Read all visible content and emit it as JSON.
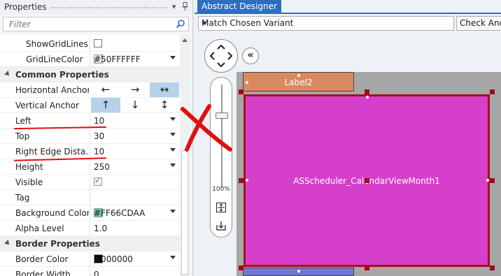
{
  "properties_panel": {
    "title": "Properties",
    "pin_icon": "pin-icon",
    "dropdown_icon": "chevron-down-icon",
    "filter_placeholder": "Filter",
    "rows": {
      "show_grid_lines": {
        "name": "ShowGridLines",
        "checked": false
      },
      "grid_line_color": {
        "name": "GridLineColor",
        "value": "#50FFFFFF"
      },
      "common_properties": {
        "label": "Common Properties"
      },
      "horizontal_anchor": {
        "name": "Horizontal Anchor",
        "options": [
          "←",
          "→",
          "↔"
        ],
        "selected": "↔"
      },
      "vertical_anchor": {
        "name": "Vertical Anchor",
        "options": [
          "↑",
          "↓",
          "↕"
        ],
        "selected": "↑"
      },
      "left": {
        "name": "Left",
        "value": "10"
      },
      "top": {
        "name": "Top",
        "value": "30"
      },
      "right_edge_distance": {
        "name": "Right Edge Dista...",
        "value": "10"
      },
      "height": {
        "name": "Height",
        "value": "250"
      },
      "visible": {
        "name": "Visible",
        "checked": true
      },
      "tag": {
        "name": "Tag",
        "value": ""
      },
      "background_color": {
        "name": "Background Color",
        "value": "#FF66CDAA",
        "swatch": "#66CDAA"
      },
      "alpha_level": {
        "name": "Alpha Level",
        "value": "1.0"
      },
      "border_properties": {
        "label": "Border Properties"
      },
      "border_color": {
        "name": "Border Color",
        "value": "#000000",
        "swatch": "#000000"
      },
      "border_width": {
        "name": "Border Width",
        "value": "0"
      }
    }
  },
  "designer": {
    "tab_title": "Abstract Designer",
    "variant_select": "Match Chosen Variant",
    "check_anchors_button": "Check Anch",
    "zoom_level": "100%",
    "views": {
      "label2": "Label2",
      "main_view": "ASScheduler_CalendarViewMonth1"
    },
    "colors": {
      "label2": "#D9895F",
      "main_view": "#D63FC9",
      "selection_border": "#A8101E",
      "canvas": "#A7A7A7",
      "tab_accent": "#2D6EBF",
      "annotation_red": "#E01010"
    }
  }
}
